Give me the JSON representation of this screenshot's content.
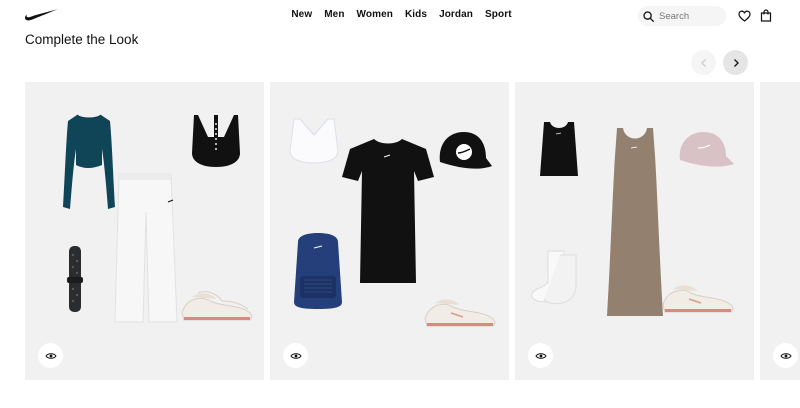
{
  "header": {
    "logo": "swoosh-logo",
    "nav": [
      "New",
      "Men",
      "Women",
      "Kids",
      "Jordan",
      "Sport"
    ],
    "search_placeholder": "Search",
    "icons": [
      "search-icon",
      "heart-icon",
      "bag-icon"
    ]
  },
  "section": {
    "title": "Complete the Look"
  },
  "carousel": {
    "prev_icon": "chevron-left-icon",
    "next_icon": "chevron-right-icon",
    "prev_enabled": false
  },
  "cards": [
    {
      "items": [
        "cropped-long-sleeve-top",
        "sports-bra",
        "wide-leg-pants",
        "watch-band",
        "sneakers"
      ]
    },
    {
      "items": [
        "sports-bra",
        "t-shirt-dress",
        "cap",
        "backpack",
        "sneakers"
      ]
    },
    {
      "items": [
        "crop-tank",
        "midi-dress",
        "cap",
        "socks",
        "sneakers"
      ]
    },
    {
      "items": []
    }
  ],
  "colors": {
    "card_bg": "#f1f1f1",
    "text": "#111111",
    "teal": "#0f4557",
    "taupe": "#94806f",
    "navy": "#243f7a",
    "pink": "#d9c2c6"
  }
}
